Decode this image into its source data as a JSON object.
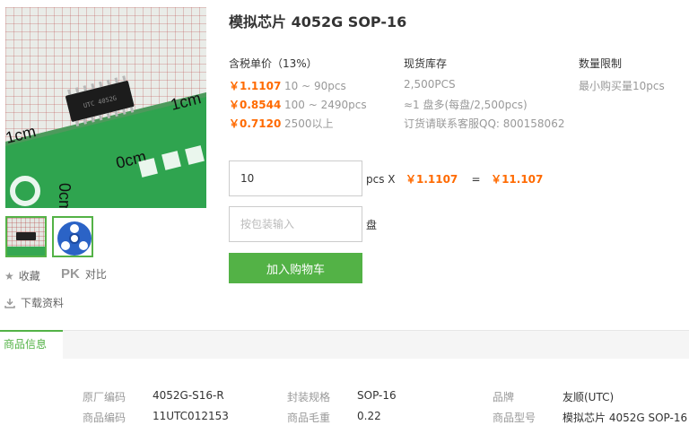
{
  "product": {
    "title": "模拟芯片 4052G SOP-16",
    "chip_marking": "UTC 4052G",
    "ruler_labels": [
      "1cm",
      "0cm",
      "0cm",
      "1cm"
    ]
  },
  "gallery": {
    "actions": {
      "favorite": "收藏",
      "compare_prefix": "PK",
      "compare": "对比",
      "download": "下载资料"
    }
  },
  "pricing": {
    "header": "含税单价（13%）",
    "tiers": [
      {
        "price": "￥1.1107",
        "qty": "10 ~ 90pcs"
      },
      {
        "price": "￥0.8544",
        "qty": "100 ~ 2490pcs"
      },
      {
        "price": "￥0.7120",
        "qty": "2500以上"
      }
    ]
  },
  "stock": {
    "header": "现货库存",
    "lines": [
      "2,500PCS",
      "≈1 盘多(每盘/2,500pcs)",
      "订货请联系客服QQ: 800158062"
    ]
  },
  "limit": {
    "header": "数量限制",
    "text": "最小购买量10pcs"
  },
  "order": {
    "quantity_value": "10",
    "unit": "pcs X",
    "unit_price": "￥1.1107",
    "equals": "=",
    "total": "￥11.107",
    "package_placeholder": "按包装输入",
    "package_unit": "盘",
    "add_to_cart": "加入购物车"
  },
  "tabs": {
    "product_info": "商品信息"
  },
  "info": {
    "rows": [
      [
        {
          "label": "原厂编码",
          "value": "4052G-S16-R"
        },
        {
          "label": "封装规格",
          "value": "SOP-16"
        },
        {
          "label": "品牌",
          "value": "友顺(UTC)"
        }
      ],
      [
        {
          "label": "商品编码",
          "value": "11UTC012153"
        },
        {
          "label": "商品毛重",
          "value": "0.22"
        },
        {
          "label": "商品型号",
          "value": "模拟芯片 4052G SOP-16"
        }
      ]
    ]
  },
  "colors": {
    "accent_green": "#53b246",
    "price_orange": "#ff6a00"
  }
}
